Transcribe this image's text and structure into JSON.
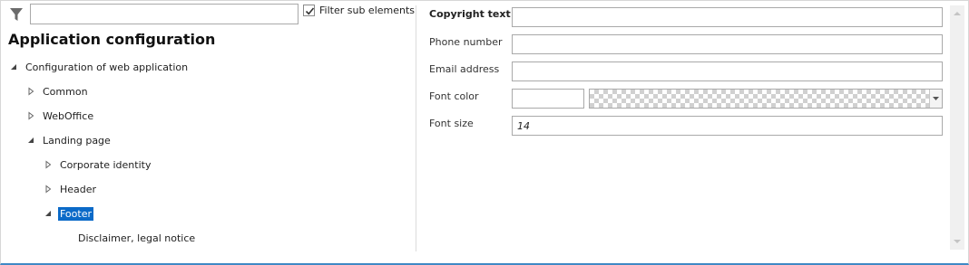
{
  "filter": {
    "icon": "filter-icon",
    "input_value": "",
    "filter_sub_elements_label": "Filter sub elements",
    "filter_sub_elements_checked": true
  },
  "title": "Application configuration",
  "tree": {
    "root": "Configuration of web application",
    "common": "Common",
    "weboffice": "WebOffice",
    "landing_page": "Landing page",
    "corporate_identity": "Corporate identity",
    "header": "Header",
    "footer": "Footer",
    "disclaimer": "Disclaimer, legal notice"
  },
  "form": {
    "copyright_label": "Copyright text",
    "copyright_value": "",
    "phone_label": "Phone number",
    "phone_value": "",
    "email_label": "Email address",
    "email_value": "",
    "font_color_label": "Font color",
    "font_color_value": "",
    "font_size_label": "Font size",
    "font_size_value": "14"
  },
  "colors": {
    "selection": "#0b6ac8",
    "bottom_border": "#3f88c5"
  }
}
